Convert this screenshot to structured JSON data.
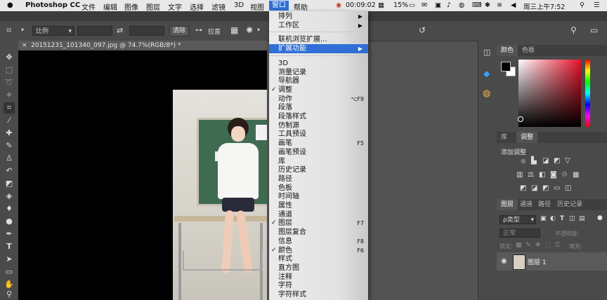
{
  "menubar": {
    "app_name": "Photoshop CC",
    "items": [
      "文件",
      "编辑",
      "图像",
      "图层",
      "文字",
      "选择",
      "滤镜",
      "3D",
      "视图",
      "窗口",
      "帮助"
    ],
    "selected_item": "窗口",
    "timer": "00:09:02",
    "battery": "15%",
    "clock": "周三上午7:52"
  },
  "options_bar": {
    "ratio_select": "比例",
    "clear_button": "清除",
    "straighten_button": "拉直"
  },
  "document": {
    "tab_title": "20151231_101340_097.jpg @ 74.7%(RGB/8*) *"
  },
  "window_menu": {
    "items": [
      {
        "label": "排列",
        "arrow": "▶"
      },
      {
        "label": "工作区",
        "arrow": "▶"
      },
      {
        "label": "联机浏览扩展..."
      },
      {
        "label": "扩展功能",
        "arrow": "▶",
        "highlight": true
      },
      {
        "label": "3D"
      },
      {
        "label": "测量记录"
      },
      {
        "label": "导航器"
      },
      {
        "label": "调整",
        "checked": true
      },
      {
        "label": "动作",
        "shortcut": "⌥F9"
      },
      {
        "label": "段落"
      },
      {
        "label": "段落样式"
      },
      {
        "label": "仿制源"
      },
      {
        "label": "工具预设"
      },
      {
        "label": "画笔",
        "shortcut": "F5"
      },
      {
        "label": "画笔预设"
      },
      {
        "label": "库"
      },
      {
        "label": "历史记录"
      },
      {
        "label": "路径"
      },
      {
        "label": "色板"
      },
      {
        "label": "时间轴"
      },
      {
        "label": "属性"
      },
      {
        "label": "通道"
      },
      {
        "label": "图层",
        "checked": true,
        "shortcut": "F7"
      },
      {
        "label": "图层复合"
      },
      {
        "label": "信息",
        "shortcut": "F8"
      },
      {
        "label": "颜色",
        "checked": true,
        "shortcut": "F6"
      },
      {
        "label": "样式"
      },
      {
        "label": "直方图"
      },
      {
        "label": "注释"
      },
      {
        "label": "字符"
      },
      {
        "label": "字符样式"
      }
    ],
    "check_glyph": "✓"
  },
  "color_panel": {
    "tabs": [
      "颜色",
      "色板"
    ]
  },
  "adjust_panel": {
    "tabs": [
      "库",
      "调整"
    ],
    "add_label": "添加调整"
  },
  "layers_panel": {
    "tabs": [
      "图层",
      "通道",
      "路径",
      "历史记录"
    ],
    "filter_label": "ρ类型",
    "blend_mode": "正常",
    "opacity_label": "不透明度:",
    "lock_label": "锁定:",
    "fill_label": "填充:",
    "layer_name": "图层 1"
  },
  "colors": {
    "menu_highlight": "#2f6fd6",
    "panel_bg": "#4a4a4a",
    "canvas": "#000000"
  }
}
